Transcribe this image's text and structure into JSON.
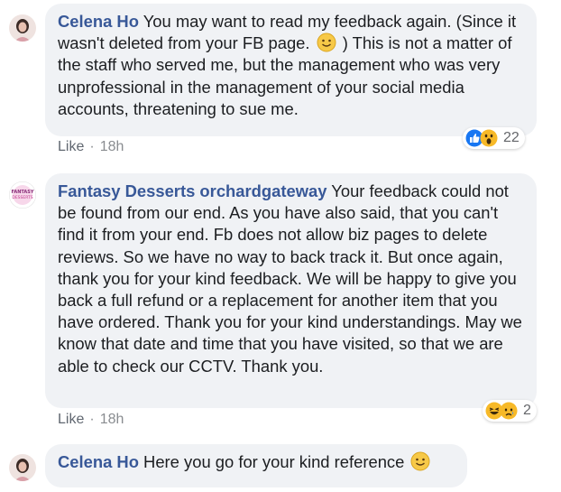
{
  "comments": [
    {
      "author": "Celena Ho",
      "text_before": " You may want to read my feedback again. (Since it wasn't deleted from your FB page. ",
      "text_after": " ) This is not a matter of the staff who served me, but the management who was very unprofessional in the management of your social media accounts, threatening to sue me.",
      "like_label": "Like",
      "separator": "·",
      "time": "18h",
      "reaction_count": "22",
      "reaction_icons": [
        "like-icon",
        "wow-icon"
      ],
      "colors": {
        "like": "#1877f2",
        "wow": "#f7b928"
      }
    },
    {
      "author": "Fantasy Desserts orchardgateway",
      "text": " Your feedback could not be found from our end. As you have also said, that you can't find it from your end. Fb does not allow biz pages to delete reviews. So we have no way to back track it. But once again, thank you for your kind feedback. We will be happy to give you back a full refund or a replacement for another item that you have ordered. Thank you for your kind understandings. May we know that date and time that you have visited, so that we are able to check our CCTV. Thank you.",
      "like_label": "Like",
      "separator": "·",
      "time": "18h",
      "reaction_count": "2",
      "reaction_icons": [
        "haha-icon",
        "sad-icon"
      ],
      "avatar_text": "FANTASY DESSERTS"
    },
    {
      "author": "Celena Ho",
      "text": " Here you go for your kind reference "
    }
  ],
  "colors": {
    "bubble": "#f0f2f5",
    "author": "#385898",
    "meta": "#8a8d91"
  }
}
